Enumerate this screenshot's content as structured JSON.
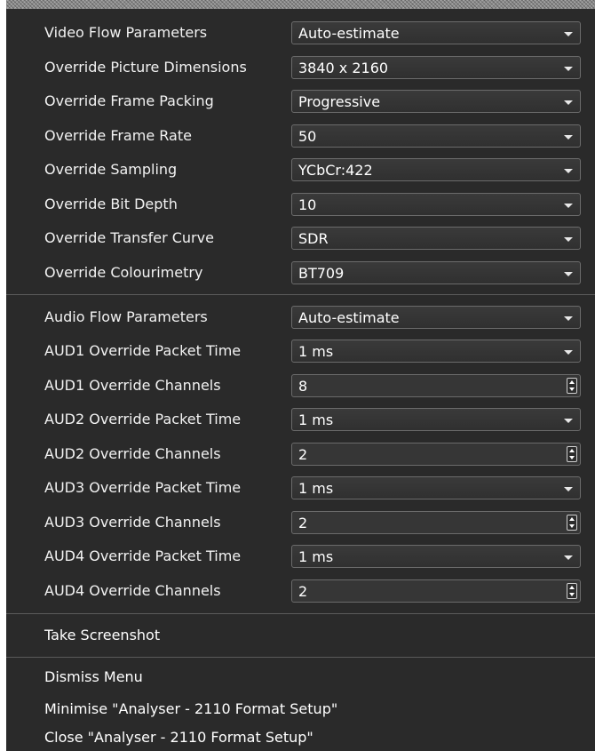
{
  "video": {
    "rows": [
      {
        "label": "Video Flow Parameters",
        "value": "Auto-estimate"
      },
      {
        "label": "Override Picture Dimensions",
        "value": "3840 x 2160"
      },
      {
        "label": "Override Frame Packing",
        "value": "Progressive"
      },
      {
        "label": "Override Frame Rate",
        "value": "50"
      },
      {
        "label": "Override Sampling",
        "value": "YCbCr:422"
      },
      {
        "label": "Override Bit Depth",
        "value": "10"
      },
      {
        "label": "Override Transfer Curve",
        "value": "SDR"
      },
      {
        "label": "Override Colourimetry",
        "value": "BT709"
      }
    ]
  },
  "audio": {
    "rows": [
      {
        "label": "Audio Flow Parameters",
        "value": "Auto-estimate"
      },
      {
        "label": "AUD1 Override Packet Time",
        "value": "1 ms"
      },
      {
        "label": "AUD1 Override Channels",
        "value": "8"
      },
      {
        "label": "AUD2 Override Packet Time",
        "value": "1 ms"
      },
      {
        "label": "AUD2 Override Channels",
        "value": "2"
      },
      {
        "label": "AUD3 Override Packet Time",
        "value": "1 ms"
      },
      {
        "label": "AUD3 Override Channels",
        "value": "2"
      },
      {
        "label": "AUD4 Override Packet Time",
        "value": "1 ms"
      },
      {
        "label": "AUD4 Override Channels",
        "value": "2"
      }
    ]
  },
  "actions": {
    "take_screenshot": "Take Screenshot",
    "dismiss_menu": "Dismiss Menu",
    "minimise": "Minimise \"Analyser - 2110 Format Setup\"",
    "close": "Close \"Analyser - 2110 Format Setup\""
  },
  "icons": {
    "dropdown": "chevron-down-icon",
    "spinner": "spin-updown-icon"
  },
  "colors": {
    "panel_bg": "#2a2a2a",
    "field_border": "#6b6b6b",
    "text": "#ffffff"
  }
}
